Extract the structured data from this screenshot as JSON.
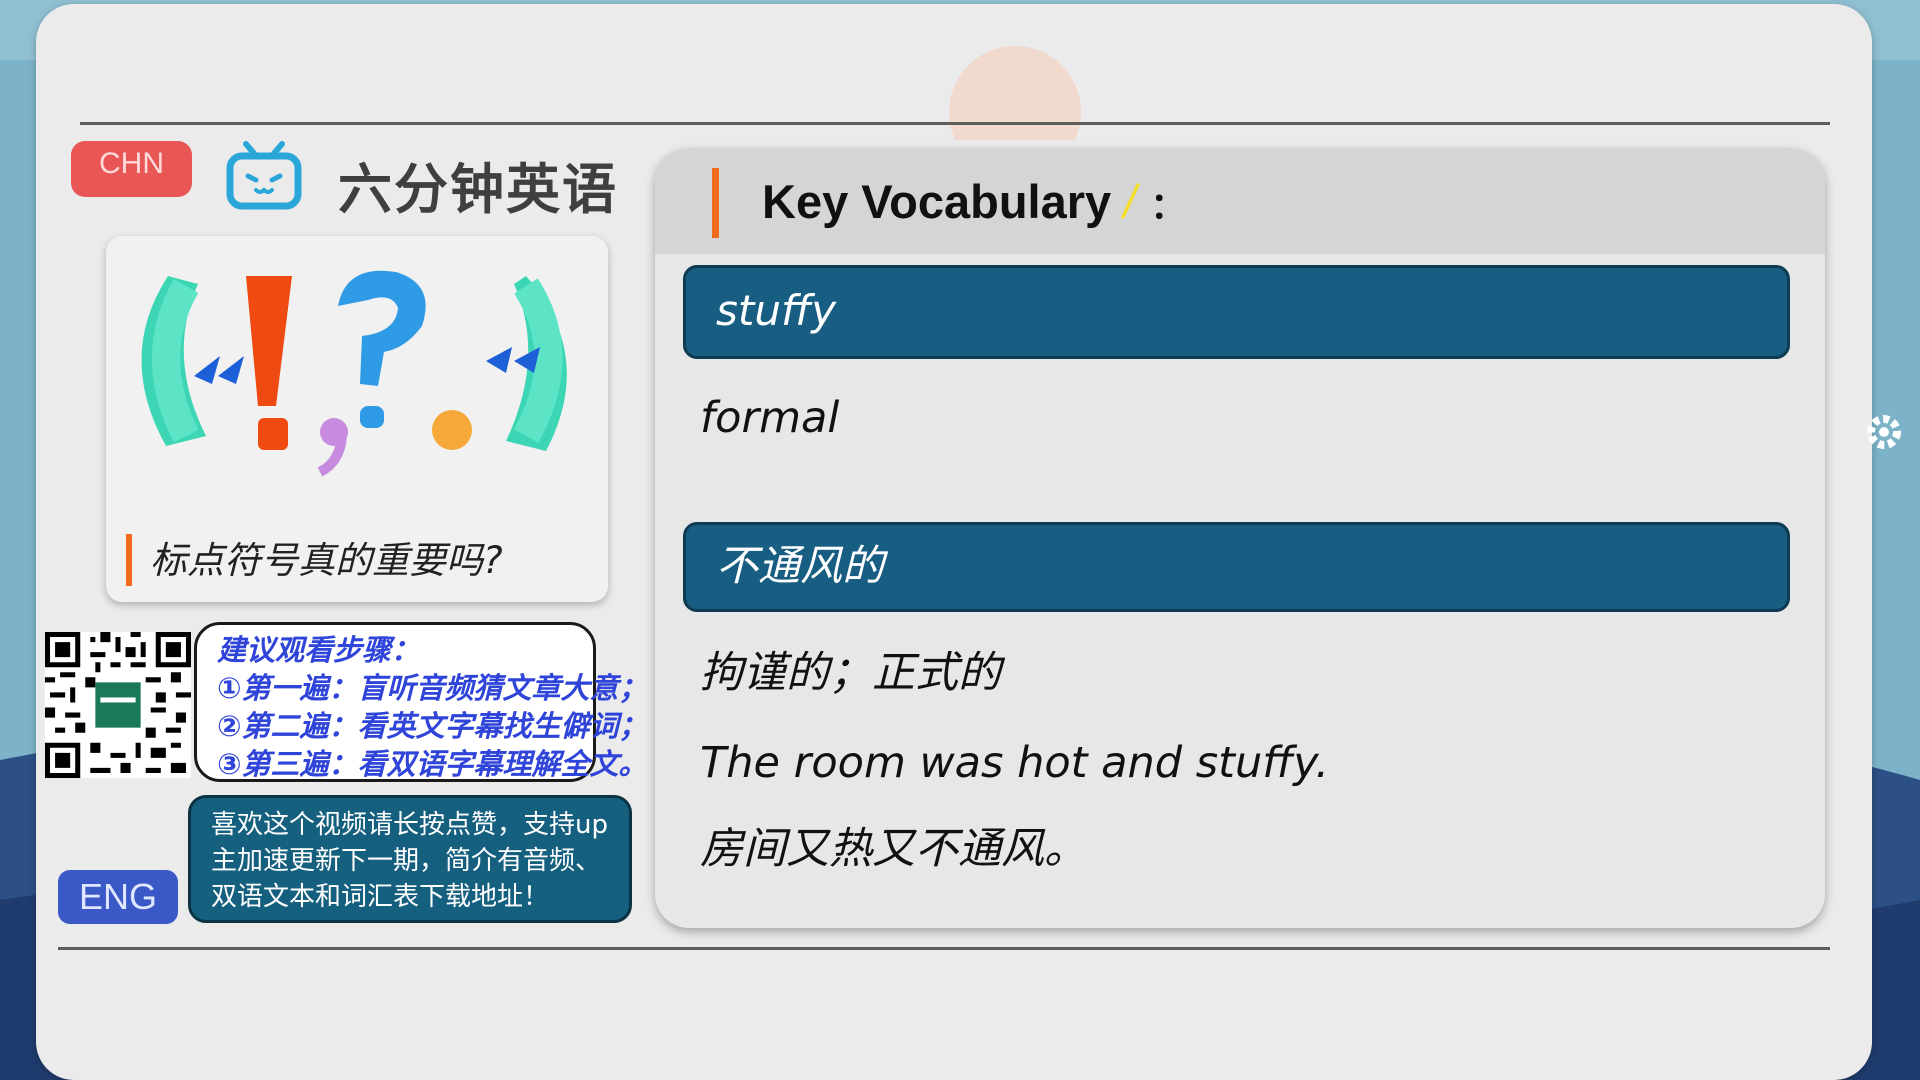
{
  "brand": {
    "lang_toggle_top": "CHN",
    "title": "六分钟英语",
    "lang_toggle_bottom": "ENG"
  },
  "episode": {
    "caption": "标点符号真的重要吗?"
  },
  "steps": [
    "建议观看步骤：",
    "①第一遍：盲听音频猜文章大意；",
    "②第二遍：看英文字幕找生僻词；",
    "③第三遍：看双语字幕理解全文。"
  ],
  "promo": "喜欢这个视频请长按点赞，支持up主加速更新下一期，简介有音频、双语文本和词汇表下载地址！",
  "vocab": {
    "heading": "Key Vocabulary",
    "heading_mark": "/",
    "heading_colon": "：",
    "term": "stuffy",
    "register": "formal",
    "translation": "不通风的",
    "meaning": "拘谨的；正式的",
    "example_en": "The room was hot and stuffy.",
    "example_zh": "房间又热又不通风。"
  },
  "colors": {
    "accent_orange": "#f26b1d",
    "term_bar": "#185e82",
    "chn_button": "#e85656",
    "eng_button": "#3a58c6",
    "steps_text": "#2f44d8"
  }
}
